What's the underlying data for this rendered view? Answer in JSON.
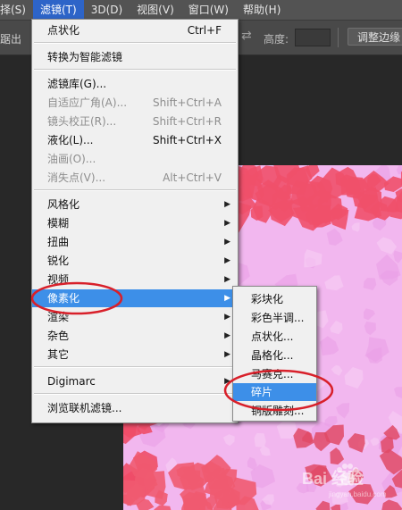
{
  "menubar": {
    "items": [
      "择(S)",
      "滤镜(T)",
      "3D(D)",
      "视图(V)",
      "窗口(W)",
      "帮助(H)"
    ],
    "active_index": 1
  },
  "options_bar": {
    "left_label": "踞出",
    "arrow_glyph": "⇄",
    "height_label": "高度:",
    "height_value": "",
    "refine_button": "调整边缘"
  },
  "filter_menu": {
    "items": [
      {
        "label": "点状化",
        "shortcut": "Ctrl+F",
        "enabled": true,
        "submenu": false
      },
      {
        "label": "转换为智能滤镜",
        "shortcut": "",
        "enabled": true,
        "submenu": false
      },
      {
        "label": "滤镜库(G)...",
        "shortcut": "",
        "enabled": true,
        "submenu": false
      },
      {
        "label": "自适应广角(A)...",
        "shortcut": "Shift+Ctrl+A",
        "enabled": false,
        "submenu": false
      },
      {
        "label": "镜头校正(R)...",
        "shortcut": "Shift+Ctrl+R",
        "enabled": false,
        "submenu": false
      },
      {
        "label": "液化(L)...",
        "shortcut": "Shift+Ctrl+X",
        "enabled": true,
        "submenu": false
      },
      {
        "label": "油画(O)...",
        "shortcut": "",
        "enabled": false,
        "submenu": false
      },
      {
        "label": "消失点(V)...",
        "shortcut": "Alt+Ctrl+V",
        "enabled": false,
        "submenu": false
      },
      {
        "label": "风格化",
        "shortcut": "",
        "enabled": true,
        "submenu": true
      },
      {
        "label": "模糊",
        "shortcut": "",
        "enabled": true,
        "submenu": true
      },
      {
        "label": "扭曲",
        "shortcut": "",
        "enabled": true,
        "submenu": true
      },
      {
        "label": "锐化",
        "shortcut": "",
        "enabled": true,
        "submenu": true
      },
      {
        "label": "视频",
        "shortcut": "",
        "enabled": true,
        "submenu": true
      },
      {
        "label": "像素化",
        "shortcut": "",
        "enabled": true,
        "submenu": true,
        "highlighted": true
      },
      {
        "label": "渲染",
        "shortcut": "",
        "enabled": true,
        "submenu": true
      },
      {
        "label": "杂色",
        "shortcut": "",
        "enabled": true,
        "submenu": true
      },
      {
        "label": "其它",
        "shortcut": "",
        "enabled": true,
        "submenu": true
      },
      {
        "label": "Digimarc",
        "shortcut": "",
        "enabled": true,
        "submenu": true
      },
      {
        "label": "浏览联机滤镜...",
        "shortcut": "",
        "enabled": true,
        "submenu": false
      }
    ]
  },
  "pixelate_submenu": {
    "items": [
      "彩块化",
      "彩色半调...",
      "点状化...",
      "晶格化...",
      "马赛克...",
      "碎片",
      "铜版雕刻..."
    ],
    "highlighted_index": 5
  },
  "colors": {
    "menubar_bg": "#535353",
    "menubar_active": "#2d64c8",
    "menu_bg": "#f0f0f0",
    "highlight": "#3d8fe8",
    "annotation": "#d8202a",
    "canvas_pink": "#f2b7ef",
    "canvas_red": "#f0506a"
  },
  "watermark": {
    "text": "Bai 经验",
    "sub": "jingyan.baidu.com"
  }
}
